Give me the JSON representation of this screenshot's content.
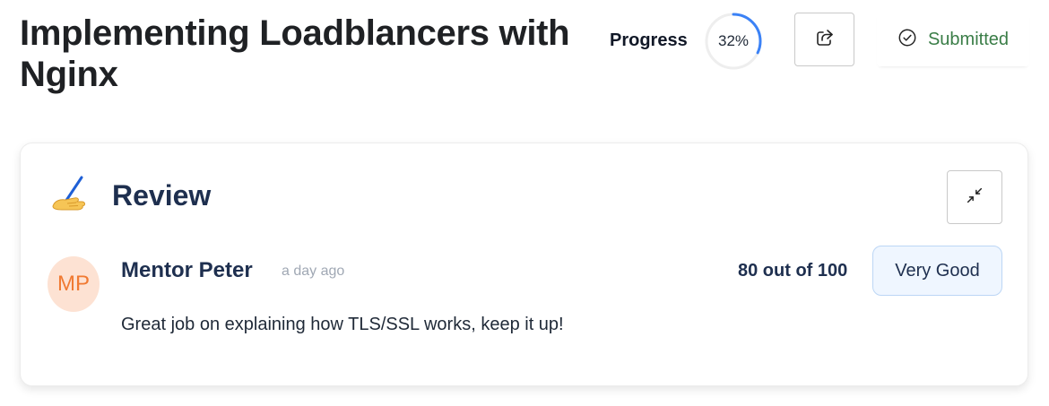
{
  "header": {
    "title": "Implementing Loadblancers with Nginx",
    "progress_label": "Progress",
    "progress_value_text": "32%",
    "progress_fraction": 0.32,
    "share_icon": "share-icon",
    "status_icon": "check-circle-icon",
    "status_label": "Submitted"
  },
  "review": {
    "emoji_icon": "writing-hand-icon",
    "heading": "Review",
    "collapse_icon": "collapse-arrows-icon",
    "reviewer": {
      "initials": "MP",
      "name": "Mentor Peter",
      "time": "a day ago"
    },
    "score_text": "80 out of 100",
    "grade": "Very Good",
    "comment": "Great job on explaining how TLS/SSL works, keep it up!"
  },
  "colors": {
    "accent_blue": "#3b82f6",
    "status_green": "#3a7d47",
    "heading_navy": "#1e2f4f",
    "avatar_bg": "#fde2d3",
    "avatar_text": "#f07a32",
    "grade_bg": "#eff6ff"
  }
}
